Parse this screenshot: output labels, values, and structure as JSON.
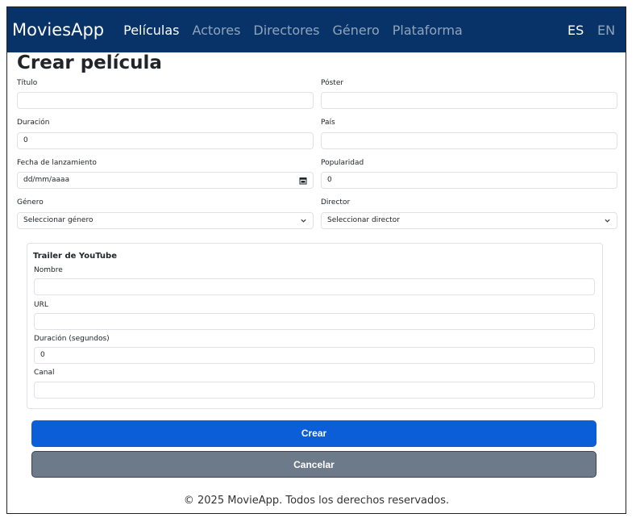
{
  "navbar": {
    "brand": "MoviesApp",
    "links": [
      "Películas",
      "Actores",
      "Directores",
      "Género",
      "Plataforma"
    ],
    "active_index": 0,
    "languages": [
      "ES",
      "EN"
    ]
  },
  "page": {
    "title": "Crear película"
  },
  "form": {
    "titulo": {
      "label": "Título",
      "value": ""
    },
    "poster": {
      "label": "Póster",
      "value": ""
    },
    "duracion": {
      "label": "Duración",
      "value": "0"
    },
    "pais": {
      "label": "País",
      "value": ""
    },
    "fecha": {
      "label": "Fecha de lanzamiento",
      "value": "dd/mm/aaaa"
    },
    "popularidad": {
      "label": "Popularidad",
      "value": "0"
    },
    "genero": {
      "label": "Género",
      "selected": "Seleccionar género"
    },
    "director": {
      "label": "Director",
      "selected": "Seleccionar director"
    }
  },
  "trailer": {
    "title": "Trailer de YouTube",
    "nombre": {
      "label": "Nombre",
      "value": ""
    },
    "url": {
      "label": "URL",
      "value": ""
    },
    "duracion": {
      "label": "Duración (segundos)",
      "value": "0"
    },
    "canal": {
      "label": "Canal",
      "value": ""
    }
  },
  "buttons": {
    "create": "Crear",
    "cancel": "Cancelar"
  },
  "footer": {
    "text": "© 2025 MovieApp. Todos los derechos reservados."
  },
  "colors": {
    "navbar": "#073368",
    "primary": "#0b5ed7",
    "secondary": "#6c7a89"
  }
}
